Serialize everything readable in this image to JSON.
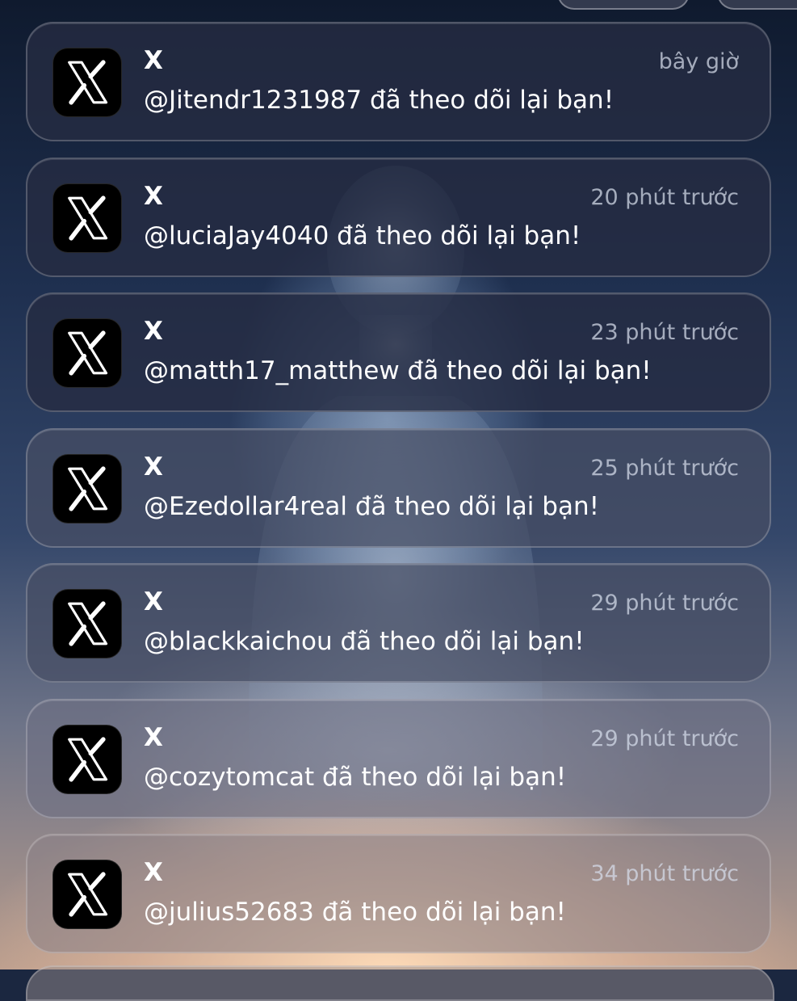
{
  "notifications": [
    {
      "app": "X",
      "time": "bây giờ",
      "message": "@Jitendr1231987 đã theo dõi lại bạn!"
    },
    {
      "app": "X",
      "time": "20 phút trước",
      "message": "@luciaJay4040 đã theo dõi lại bạn!"
    },
    {
      "app": "X",
      "time": "23 phút trước",
      "message": "@matth17_matthew đã theo dõi lại bạn!"
    },
    {
      "app": "X",
      "time": "25 phút trước",
      "message": "@Ezedollar4real đã theo dõi lại bạn!"
    },
    {
      "app": "X",
      "time": "29 phút trước",
      "message": "@blackkaichou đã theo dõi lại bạn!"
    },
    {
      "app": "X",
      "time": "29 phút trước",
      "message": "@cozytomcat đã theo dõi lại bạn!"
    },
    {
      "app": "X",
      "time": "34 phút trước",
      "message": "@julius52683 đã theo dõi lại bạn!"
    }
  ],
  "icon": "x-logo-icon",
  "colors": {
    "card_bg": "#262c42",
    "text_primary": "#ffffff",
    "text_secondary": "#d7deeb"
  }
}
